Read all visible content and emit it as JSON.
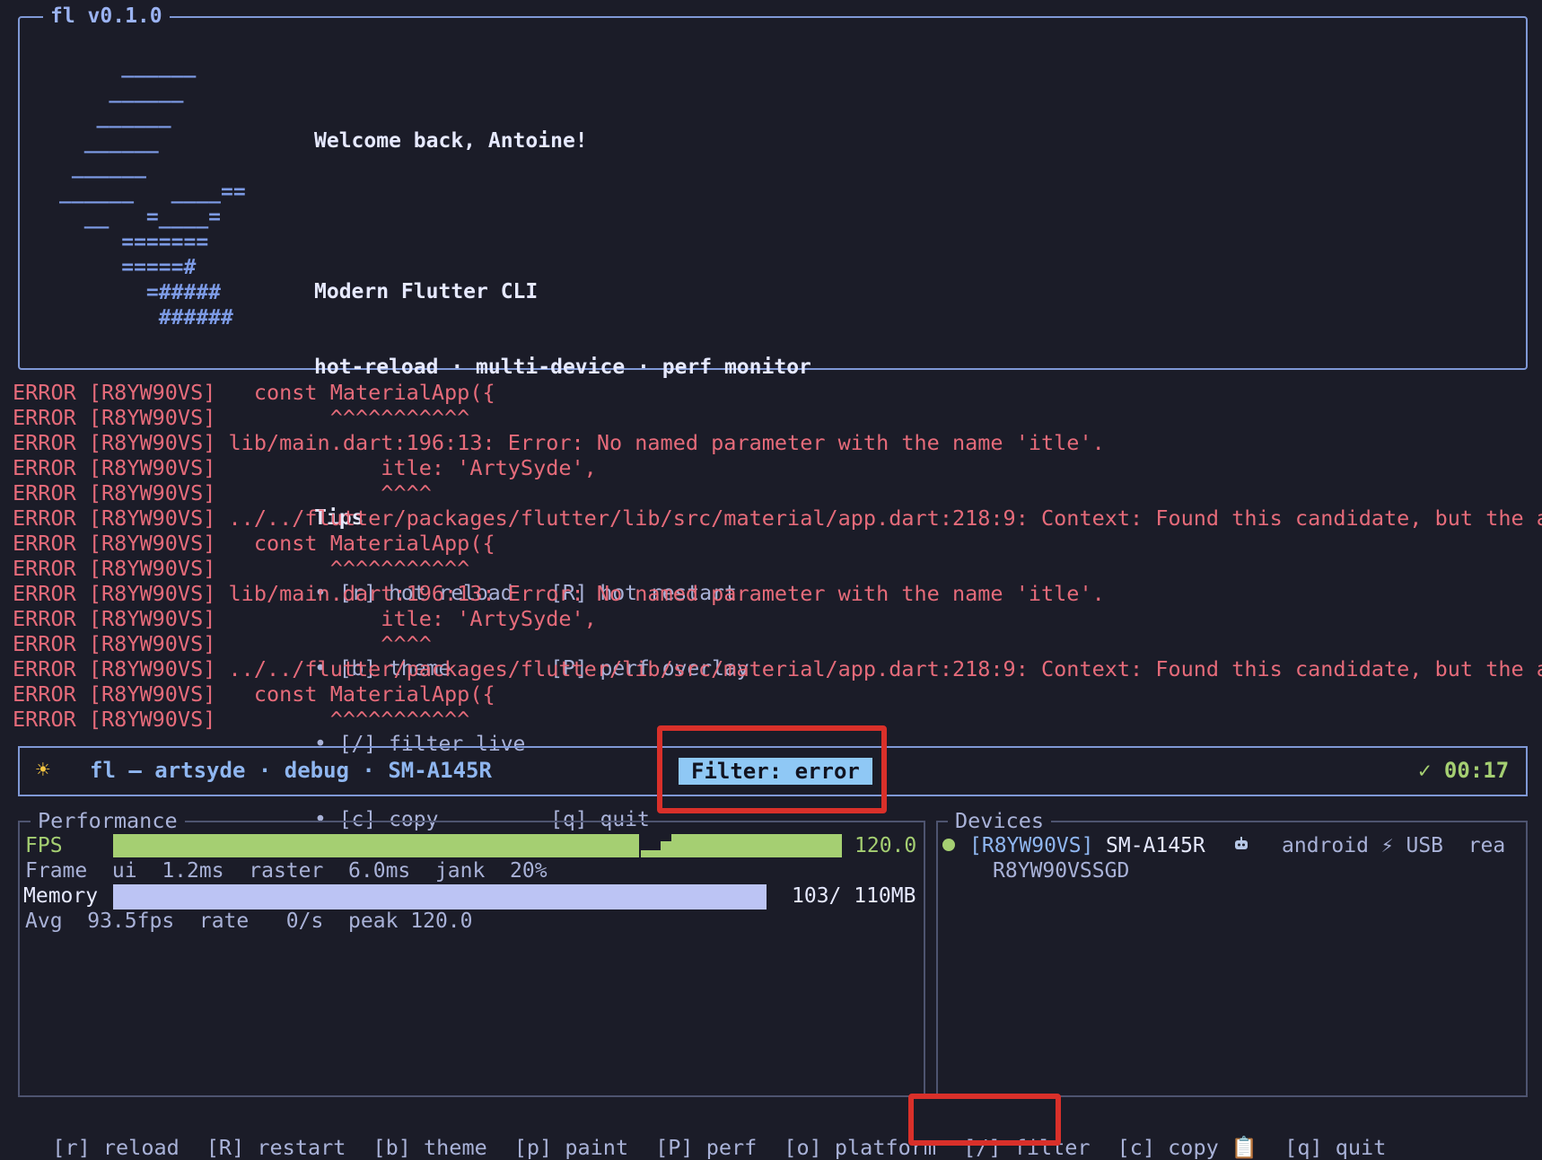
{
  "colors": {
    "background": "#1b1c28",
    "border": "#7f98d6",
    "error": "#e66b7a",
    "accent": "#8fc8f5",
    "green": "#a5cf72",
    "memory_bar": "#bcc4f4",
    "highlight_box": "#d9302a"
  },
  "header": {
    "title": "fl v0.1.0",
    "logo_lines": [
      "     ______",
      "    ______",
      "   ______",
      "  ______",
      " ______",
      "______   ____==",
      "  __   =____=",
      "     =======",
      "     =====#",
      "       =#####",
      "        ######"
    ],
    "greeting": "Welcome back, Antoine!",
    "subtitle": "Modern Flutter CLI",
    "features": "hot-reload · multi-device · perf monitor",
    "tips_title": "Tips",
    "tips": [
      "• [r] hot reload   [R] hot restart",
      "• [b] theme        [P] perf overlay",
      "• [/] filter live",
      "• [c] copy         [q] quit"
    ]
  },
  "log": {
    "lines": [
      "ERROR [R8YW90VS]   const MaterialApp({",
      "ERROR [R8YW90VS]         ^^^^^^^^^^^",
      "ERROR [R8YW90VS] lib/main.dart:196:13: Error: No named parameter with the name 'itle'.",
      "ERROR [R8YW90VS]             itle: 'ArtySyde',",
      "ERROR [R8YW90VS]             ^^^^",
      "ERROR [R8YW90VS] ../../flutter/packages/flutter/lib/src/material/app.dart:218:9: Context: Found this candidate, but the a",
      "ERROR [R8YW90VS]   const MaterialApp({",
      "ERROR [R8YW90VS]         ^^^^^^^^^^^",
      "ERROR [R8YW90VS] lib/main.dart:196:13: Error: No named parameter with the name 'itle'.",
      "ERROR [R8YW90VS]             itle: 'ArtySyde',",
      "ERROR [R8YW90VS]             ^^^^",
      "ERROR [R8YW90VS] ../../flutter/packages/flutter/lib/src/material/app.dart:218:9: Context: Found this candidate, but the a",
      "ERROR [R8YW90VS]   const MaterialApp({",
      "ERROR [R8YW90VS]         ^^^^^^^^^^^"
    ]
  },
  "status_bar": {
    "theme_icon": "sun-icon",
    "app": "fl — artsyde · debug · SM-A145R",
    "filter": "Filter: error",
    "timer": "✓ 00:17"
  },
  "performance": {
    "title": "Performance",
    "fps_label": "FPS",
    "fps_value": "120.0",
    "fps_fill": 1.0,
    "frame_line": "Frame  ui  1.2ms  raster  6.0ms  jank  20%",
    "memory_label": "Memory",
    "memory_value": "103/ 110MB",
    "memory_fill": 0.936,
    "avg_line": "Avg  93.5fps  rate   0/s  peak 120.0"
  },
  "devices": {
    "title": "Devices",
    "items": [
      {
        "id": "[R8YW90VS]",
        "name": "SM-A145R",
        "platform_icon": "android-robot-icon",
        "platform": "android ⚡ USB  rea",
        "serial": "R8YW90VSSGD"
      }
    ]
  },
  "keys": {
    "reload": "[r] reload",
    "restart": "[R] restart",
    "theme": "[b] theme",
    "paint": "[p] paint",
    "perf": "[P] perf",
    "platform": "[o] platform",
    "filter": "[/] filter",
    "copy": "[c] copy 📋",
    "quit": "[q] quit"
  }
}
